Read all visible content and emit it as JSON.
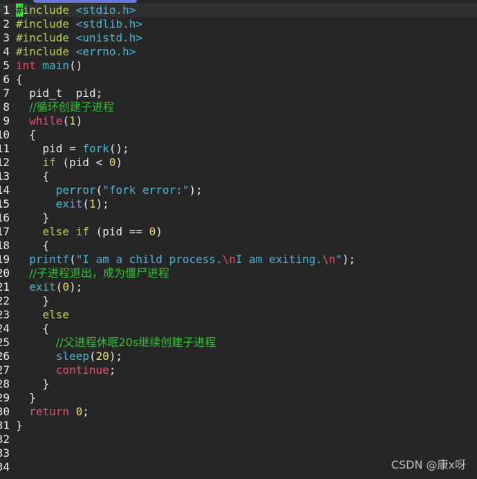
{
  "editor": {
    "lines": [
      {
        "no": "1",
        "segs": [
          {
            "c": "cursor",
            "t": "#"
          },
          {
            "c": "pre",
            "t": "include "
          },
          {
            "c": "hdr",
            "t": "<stdio.h>"
          }
        ]
      },
      {
        "no": "2",
        "segs": [
          {
            "c": "pre",
            "t": "#include "
          },
          {
            "c": "hdr",
            "t": "<stdlib.h>"
          }
        ]
      },
      {
        "no": "3",
        "segs": [
          {
            "c": "pre",
            "t": "#include "
          },
          {
            "c": "hdr",
            "t": "<unistd.h>"
          }
        ]
      },
      {
        "no": "4",
        "segs": [
          {
            "c": "pre",
            "t": "#include "
          },
          {
            "c": "hdr",
            "t": "<errno.h>"
          }
        ]
      },
      {
        "no": "5",
        "segs": [
          {
            "c": "kw",
            "t": "int "
          },
          {
            "c": "fn",
            "t": "main"
          },
          {
            "c": "id",
            "t": "()"
          }
        ]
      },
      {
        "no": "6",
        "segs": [
          {
            "c": "id",
            "t": "{"
          }
        ]
      },
      {
        "no": "7",
        "segs": [
          {
            "c": "id",
            "t": "  pid_t  pid;"
          }
        ]
      },
      {
        "no": "8",
        "segs": [
          {
            "c": "id",
            "t": "  "
          },
          {
            "c": "cm",
            "t": "//循环创建子进程"
          }
        ]
      },
      {
        "no": "9",
        "segs": [
          {
            "c": "id",
            "t": "  "
          },
          {
            "c": "kw",
            "t": "while"
          },
          {
            "c": "id",
            "t": "("
          },
          {
            "c": "num",
            "t": "1"
          },
          {
            "c": "id",
            "t": ")"
          }
        ]
      },
      {
        "no": "10",
        "segs": [
          {
            "c": "id",
            "t": "  {"
          }
        ]
      },
      {
        "no": "11",
        "segs": [
          {
            "c": "id",
            "t": "    pid = "
          },
          {
            "c": "fn",
            "t": "fork"
          },
          {
            "c": "id",
            "t": "();"
          }
        ]
      },
      {
        "no": "12",
        "segs": [
          {
            "c": "id",
            "t": "    "
          },
          {
            "c": "pre",
            "t": "if"
          },
          {
            "c": "id",
            "t": " (pid < "
          },
          {
            "c": "num",
            "t": "0"
          },
          {
            "c": "id",
            "t": ")"
          }
        ]
      },
      {
        "no": "13",
        "segs": [
          {
            "c": "id",
            "t": "    {"
          }
        ]
      },
      {
        "no": "14",
        "segs": [
          {
            "c": "id",
            "t": "      "
          },
          {
            "c": "fn",
            "t": "perror"
          },
          {
            "c": "id",
            "t": "("
          },
          {
            "c": "str",
            "t": "\"fork error:\""
          },
          {
            "c": "id",
            "t": ");"
          }
        ]
      },
      {
        "no": "15",
        "segs": [
          {
            "c": "id",
            "t": "      "
          },
          {
            "c": "fn",
            "t": "exit"
          },
          {
            "c": "id",
            "t": "("
          },
          {
            "c": "num",
            "t": "1"
          },
          {
            "c": "id",
            "t": ");"
          }
        ]
      },
      {
        "no": "16",
        "segs": [
          {
            "c": "id",
            "t": "    }"
          }
        ]
      },
      {
        "no": "17",
        "segs": [
          {
            "c": "id",
            "t": "    "
          },
          {
            "c": "pre",
            "t": "else if"
          },
          {
            "c": "id",
            "t": " (pid == "
          },
          {
            "c": "num",
            "t": "0"
          },
          {
            "c": "id",
            "t": ")"
          }
        ]
      },
      {
        "no": "18",
        "segs": [
          {
            "c": "id",
            "t": "    {"
          }
        ]
      },
      {
        "no": "19",
        "segs": [
          {
            "c": "id",
            "t": "  "
          },
          {
            "c": "fn",
            "t": "printf"
          },
          {
            "c": "id",
            "t": "("
          },
          {
            "c": "str",
            "t": "\"I am a child process."
          },
          {
            "c": "esc",
            "t": "\\n"
          },
          {
            "c": "str",
            "t": "I am exiting."
          },
          {
            "c": "esc",
            "t": "\\n"
          },
          {
            "c": "str",
            "t": "\""
          },
          {
            "c": "id",
            "t": ");"
          }
        ]
      },
      {
        "no": "20",
        "segs": [
          {
            "c": "id",
            "t": "  "
          },
          {
            "c": "cm",
            "t": "//子进程退出，成为僵尸进程"
          }
        ]
      },
      {
        "no": "21",
        "segs": [
          {
            "c": "id",
            "t": "  "
          },
          {
            "c": "fn",
            "t": "exit"
          },
          {
            "c": "id",
            "t": "("
          },
          {
            "c": "num",
            "t": "0"
          },
          {
            "c": "id",
            "t": ");"
          }
        ]
      },
      {
        "no": "22",
        "segs": [
          {
            "c": "id",
            "t": "    }"
          }
        ]
      },
      {
        "no": "23",
        "segs": [
          {
            "c": "id",
            "t": "    "
          },
          {
            "c": "pre",
            "t": "else"
          }
        ]
      },
      {
        "no": "24",
        "segs": [
          {
            "c": "id",
            "t": "    {"
          }
        ]
      },
      {
        "no": "25",
        "segs": [
          {
            "c": "id",
            "t": "      "
          },
          {
            "c": "cm",
            "t": "//父进程休眠20s继续创建子进程"
          }
        ]
      },
      {
        "no": "26",
        "segs": [
          {
            "c": "id",
            "t": "      "
          },
          {
            "c": "fn",
            "t": "sleep"
          },
          {
            "c": "id",
            "t": "("
          },
          {
            "c": "num",
            "t": "20"
          },
          {
            "c": "id",
            "t": ");"
          }
        ]
      },
      {
        "no": "27",
        "segs": [
          {
            "c": "id",
            "t": "      "
          },
          {
            "c": "kw",
            "t": "continue"
          },
          {
            "c": "id",
            "t": ";"
          }
        ]
      },
      {
        "no": "28",
        "segs": [
          {
            "c": "id",
            "t": "    }"
          }
        ]
      },
      {
        "no": "29",
        "segs": [
          {
            "c": "id",
            "t": "  }"
          }
        ]
      },
      {
        "no": "30",
        "segs": [
          {
            "c": "id",
            "t": "  "
          },
          {
            "c": "kw",
            "t": "return"
          },
          {
            "c": "id",
            "t": " "
          },
          {
            "c": "num",
            "t": "0"
          },
          {
            "c": "id",
            "t": ";"
          }
        ]
      },
      {
        "no": "31",
        "segs": [
          {
            "c": "id",
            "t": "}"
          }
        ]
      },
      {
        "no": "32",
        "segs": []
      },
      {
        "no": "33",
        "segs": []
      },
      {
        "no": "34",
        "segs": []
      }
    ]
  },
  "watermark": "CSDN @康x呀",
  "colors": {
    "background": "#262626",
    "current_line": "#303030",
    "cursor": "#2ee82e",
    "preprocessor_keyword": "#b6d34a",
    "header_function_string": "#47b9d6",
    "type_keyword_escape": "#e5506f",
    "number": "#e8e35a",
    "comment": "#30c236"
  }
}
